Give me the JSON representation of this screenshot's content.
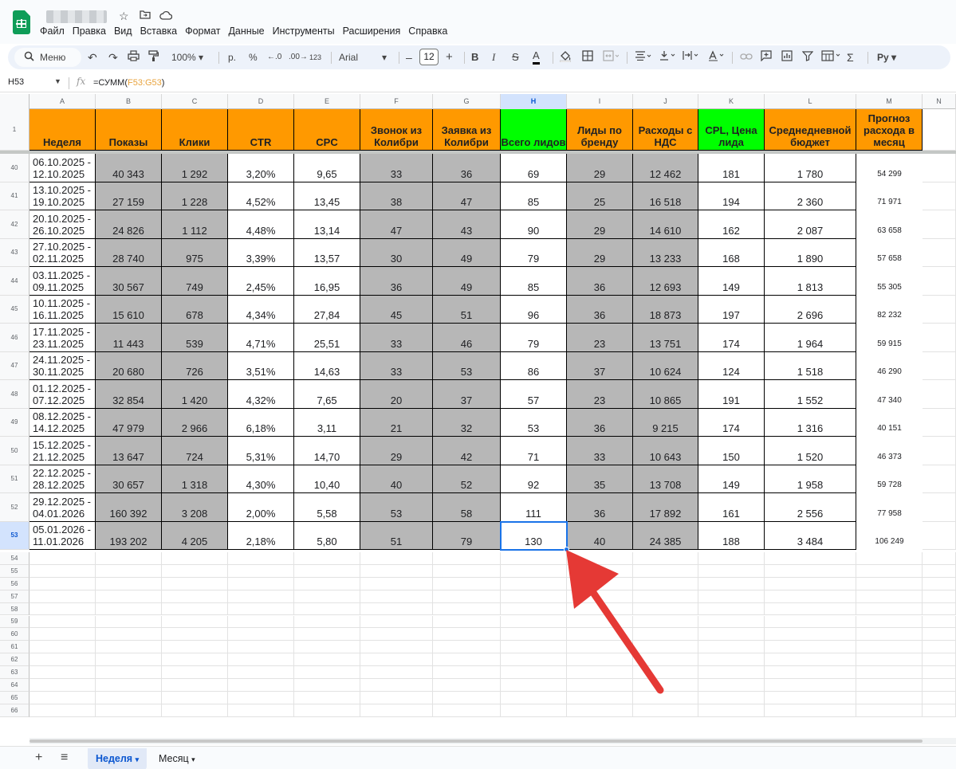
{
  "app": {
    "name": "Google Таблицы"
  },
  "header": {
    "menu": [
      "Файл",
      "Правка",
      "Вид",
      "Вставка",
      "Формат",
      "Данные",
      "Инструменты",
      "Расширения",
      "Справка"
    ]
  },
  "toolbar": {
    "search_label": "Меню",
    "zoom": "100%",
    "currency": "р.",
    "percent": "%",
    "decrease_decimals": ".0",
    "increase_decimals": ".00",
    "number_format": "123",
    "font": "Arial",
    "font_size": "12",
    "decrease_size": "–",
    "increase_size": "+",
    "bold": "B",
    "italic": "I",
    "strike": "S",
    "text_color": "A",
    "sum": "Σ"
  },
  "formula_bar": {
    "cell_ref": "H53",
    "fx": "fx",
    "formula_prefix": "=СУММ(",
    "formula_args": "F53:G53",
    "formula_suffix": ")"
  },
  "grid": {
    "columns": [
      "A",
      "B",
      "C",
      "D",
      "E",
      "F",
      "G",
      "H",
      "I",
      "J",
      "K",
      "L",
      "M",
      "N"
    ],
    "selected_column": "H",
    "header_row_number": "1",
    "headers": [
      "Неделя",
      "Показы",
      "Клики",
      "CTR",
      "CPC",
      "Звонок из Колибри",
      "Заявка из Колибри",
      "Всего лидов",
      "Лиды по бренду",
      "Расходы с НДС",
      "CPL, Цена лида",
      "Среднедневной бюджет",
      "Прогноз расхода в месяц"
    ],
    "rows": [
      {
        "num": "40",
        "cells": [
          "06.10.2025 - 12.10.2025",
          "40 343",
          "1 292",
          "3,20%",
          "9,65",
          "33",
          "36",
          "69",
          "29",
          "12 462",
          "181",
          "1 780",
          "54 299"
        ]
      },
      {
        "num": "41",
        "cells": [
          "13.10.2025 - 19.10.2025",
          "27 159",
          "1 228",
          "4,52%",
          "13,45",
          "38",
          "47",
          "85",
          "25",
          "16 518",
          "194",
          "2 360",
          "71 971"
        ]
      },
      {
        "num": "42",
        "cells": [
          "20.10.2025 - 26.10.2025",
          "24 826",
          "1 112",
          "4,48%",
          "13,14",
          "47",
          "43",
          "90",
          "29",
          "14 610",
          "162",
          "2 087",
          "63 658"
        ]
      },
      {
        "num": "43",
        "cells": [
          "27.10.2025 - 02.11.2025",
          "28 740",
          "975",
          "3,39%",
          "13,57",
          "30",
          "49",
          "79",
          "29",
          "13 233",
          "168",
          "1 890",
          "57 658"
        ]
      },
      {
        "num": "44",
        "cells": [
          "03.11.2025 - 09.11.2025",
          "30 567",
          "749",
          "2,45%",
          "16,95",
          "36",
          "49",
          "85",
          "36",
          "12 693",
          "149",
          "1 813",
          "55 305"
        ]
      },
      {
        "num": "45",
        "cells": [
          "10.11.2025 - 16.11.2025",
          "15 610",
          "678",
          "4,34%",
          "27,84",
          "45",
          "51",
          "96",
          "36",
          "18 873",
          "197",
          "2 696",
          "82 232"
        ]
      },
      {
        "num": "46",
        "cells": [
          "17.11.2025 - 23.11.2025",
          "11 443",
          "539",
          "4,71%",
          "25,51",
          "33",
          "46",
          "79",
          "23",
          "13 751",
          "174",
          "1 964",
          "59 915"
        ]
      },
      {
        "num": "47",
        "cells": [
          "24.11.2025 - 30.11.2025",
          "20 680",
          "726",
          "3,51%",
          "14,63",
          "33",
          "53",
          "86",
          "37",
          "10 624",
          "124",
          "1 518",
          "46 290"
        ]
      },
      {
        "num": "48",
        "cells": [
          "01.12.2025 - 07.12.2025",
          "32 854",
          "1 420",
          "4,32%",
          "7,65",
          "20",
          "37",
          "57",
          "23",
          "10 865",
          "191",
          "1 552",
          "47 340"
        ]
      },
      {
        "num": "49",
        "cells": [
          "08.12.2025 - 14.12.2025",
          "47 979",
          "2 966",
          "6,18%",
          "3,11",
          "21",
          "32",
          "53",
          "36",
          "9 215",
          "174",
          "1 316",
          "40 151"
        ]
      },
      {
        "num": "50",
        "cells": [
          "15.12.2025 - 21.12.2025",
          "13 647",
          "724",
          "5,31%",
          "14,70",
          "29",
          "42",
          "71",
          "33",
          "10 643",
          "150",
          "1 520",
          "46 373"
        ]
      },
      {
        "num": "51",
        "cells": [
          "22.12.2025 - 28.12.2025",
          "30 657",
          "1 318",
          "4,30%",
          "10,40",
          "40",
          "52",
          "92",
          "35",
          "13 708",
          "149",
          "1 958",
          "59 728"
        ]
      },
      {
        "num": "52",
        "cells": [
          "29.12.2025 - 04.01.2026",
          "160 392",
          "3 208",
          "2,00%",
          "5,58",
          "53",
          "58",
          "111",
          "36",
          "17 892",
          "161",
          "2 556",
          "77 958"
        ]
      },
      {
        "num": "53",
        "cells": [
          "05.01.2026 - 11.01.2026",
          "193 202",
          "4 205",
          "2,18%",
          "5,80",
          "51",
          "79",
          "130",
          "40",
          "24 385",
          "188",
          "3 484",
          "106 249"
        ]
      }
    ],
    "empty_rows": [
      "54",
      "55",
      "56",
      "57",
      "58",
      "59",
      "60",
      "61",
      "62",
      "63",
      "64",
      "65",
      "66"
    ]
  },
  "sheets": {
    "add": "+",
    "list": "≡",
    "tabs": [
      {
        "label": "Неделя",
        "active": true
      },
      {
        "label": "Месяц",
        "active": false
      }
    ]
  },
  "annotation": {
    "color": "#e53935"
  },
  "colors": {
    "orange": "#ff9900",
    "green": "#00ff00",
    "gray": "#b7b7b7",
    "selection": "#1a73e8"
  }
}
